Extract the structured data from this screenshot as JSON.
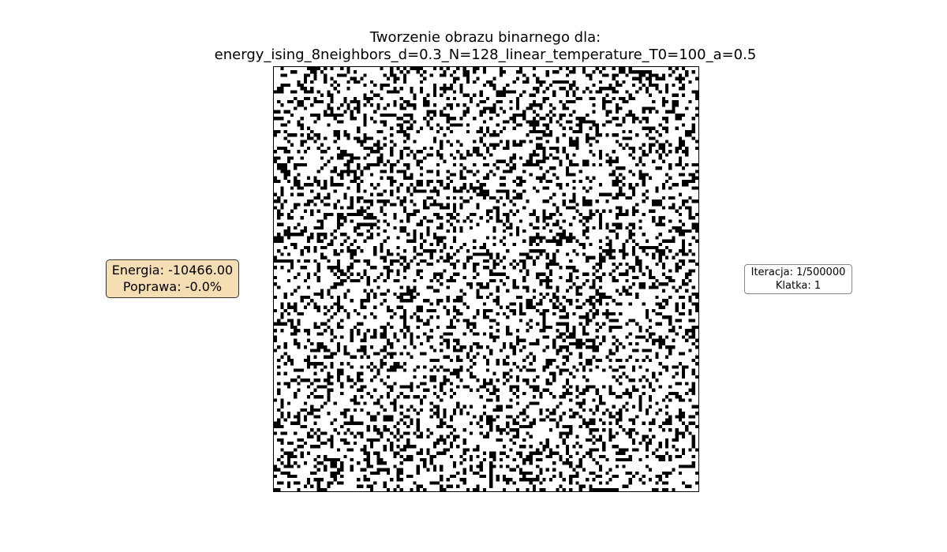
{
  "chart_data": {
    "type": "heatmap",
    "title_line1": "Tworzenie obrazu binarnego dla:",
    "title_line2": "energy_ising_8neighbors_d=0.3_N=128_linear_temperature_T0=100_a=0.5",
    "grid_size": 128,
    "density": 0.3,
    "colormap": "binary",
    "colors": {
      "on": "#000000",
      "off": "#ffffff"
    },
    "axes": "off"
  },
  "energy_panel": {
    "energy_label": "Energia: -10466.00",
    "improvement_label": "Poprawa: -0.0%",
    "background": "#f5deb3"
  },
  "iteration_panel": {
    "iteration_label": "Iteracja: 1/500000",
    "frame_label": "Klatka: 1"
  }
}
